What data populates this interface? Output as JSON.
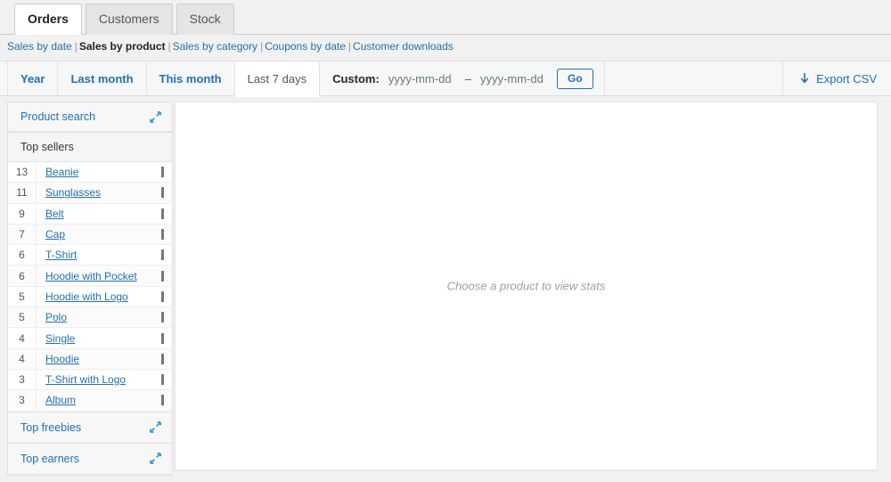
{
  "tabs": [
    {
      "label": "Orders",
      "active": true
    },
    {
      "label": "Customers",
      "active": false
    },
    {
      "label": "Stock",
      "active": false
    }
  ],
  "subnav": {
    "items": [
      {
        "label": "Sales by date",
        "current": false
      },
      {
        "label": "Sales by product",
        "current": true
      },
      {
        "label": "Sales by category",
        "current": false
      },
      {
        "label": "Coupons by date",
        "current": false
      },
      {
        "label": "Customer downloads",
        "current": false
      }
    ],
    "separator": "|"
  },
  "filters": {
    "ranges": [
      {
        "label": "Year",
        "active": false
      },
      {
        "label": "Last month",
        "active": false
      },
      {
        "label": "This month",
        "active": false
      },
      {
        "label": "Last 7 days",
        "active": true
      }
    ],
    "custom_label": "Custom:",
    "date_from": {
      "value": "",
      "placeholder": "yyyy-mm-dd"
    },
    "date_to": {
      "value": "",
      "placeholder": "yyyy-mm-dd"
    },
    "dash": "–",
    "go_label": "Go",
    "export_label": "Export CSV",
    "export_icon": "download-arrow-icon"
  },
  "sidebar": {
    "product_search": {
      "title": "Product search",
      "icon": "expand-icon"
    },
    "top_sellers": {
      "title": "Top sellers",
      "rows": [
        {
          "count": "13",
          "name": "Beanie"
        },
        {
          "count": "11",
          "name": "Sunglasses"
        },
        {
          "count": "9",
          "name": "Belt"
        },
        {
          "count": "7",
          "name": "Cap"
        },
        {
          "count": "6",
          "name": "T-Shirt"
        },
        {
          "count": "6",
          "name": "Hoodie with Pocket"
        },
        {
          "count": "5",
          "name": "Hoodie with Logo"
        },
        {
          "count": "5",
          "name": "Polo"
        },
        {
          "count": "4",
          "name": "Single"
        },
        {
          "count": "4",
          "name": "Hoodie"
        },
        {
          "count": "3",
          "name": "T-Shirt with Logo"
        },
        {
          "count": "3",
          "name": "Album"
        }
      ]
    },
    "top_freebies": {
      "title": "Top freebies",
      "icon": "expand-icon"
    },
    "top_earners": {
      "title": "Top earners",
      "icon": "expand-icon"
    }
  },
  "main": {
    "placeholder": "Choose a product to view stats"
  },
  "colors": {
    "link": "#2271b1",
    "page_bg": "#f1f1f1",
    "panel_bg": "#ffffff",
    "bar": "#777777"
  }
}
